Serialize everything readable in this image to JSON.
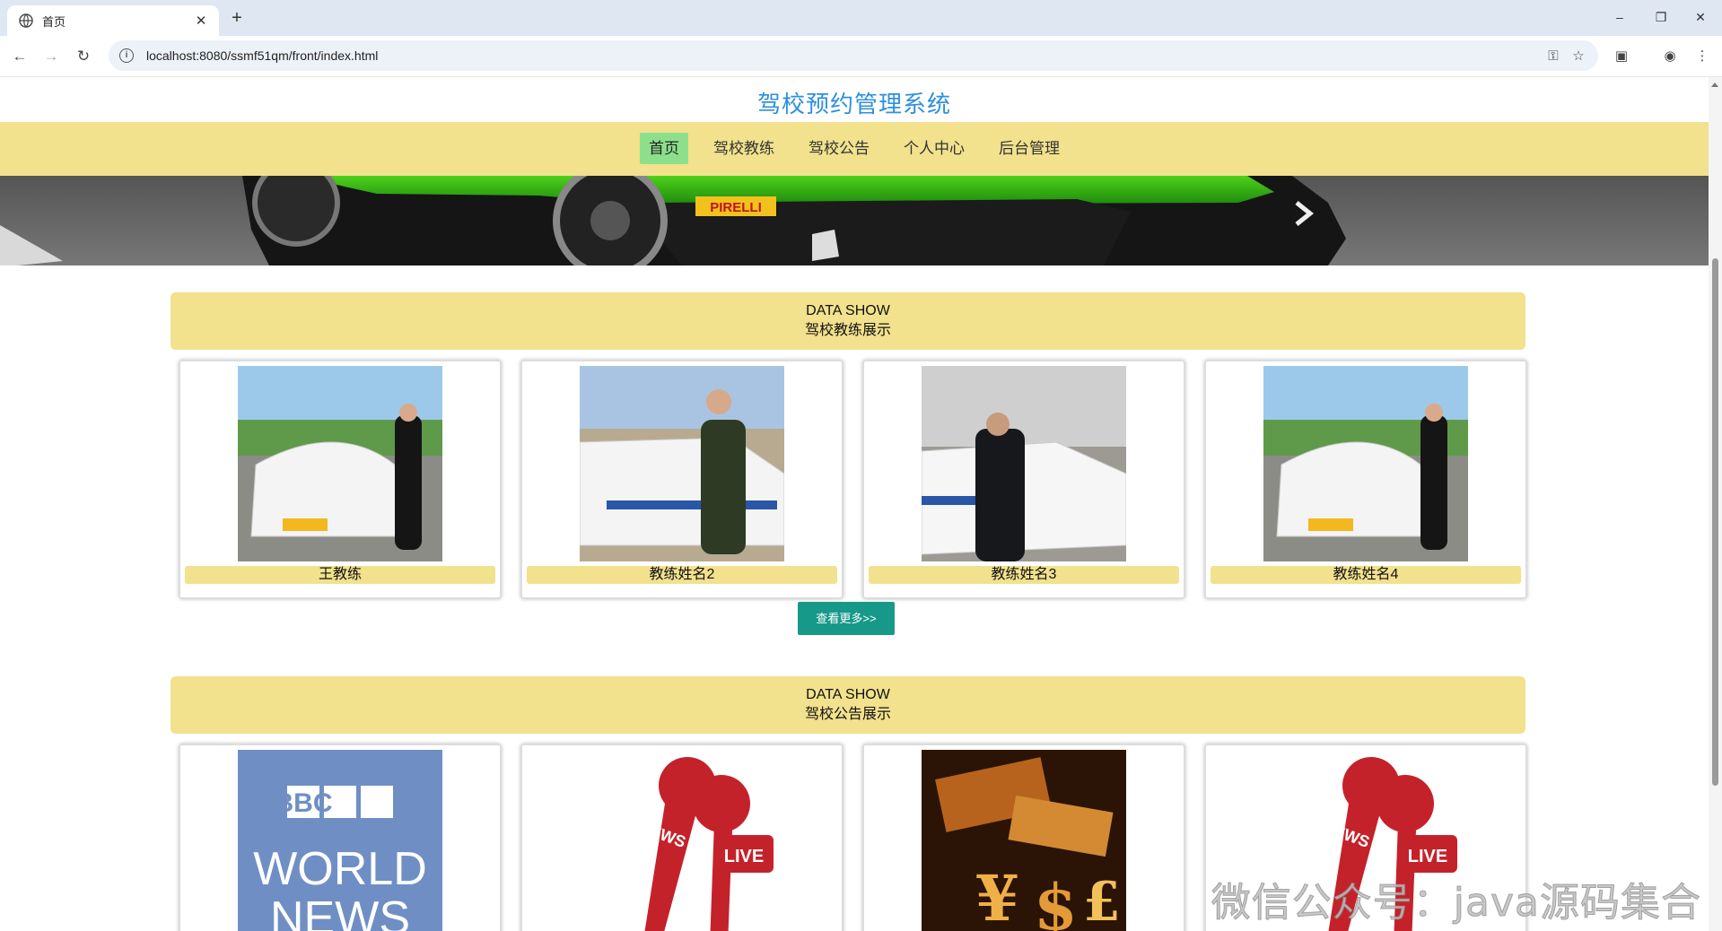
{
  "browser": {
    "tab_title": "首页",
    "new_tab": "+",
    "url": "localhost:8080/ssmf51qm/front/index.html",
    "window_controls": [
      "–",
      "❐",
      "✕"
    ]
  },
  "site": {
    "title": "驾校预约管理系统",
    "menu": [
      {
        "label": "首页",
        "active": true
      },
      {
        "label": "驾校教练",
        "active": false
      },
      {
        "label": "驾校公告",
        "active": false
      },
      {
        "label": "个人中心",
        "active": false
      },
      {
        "label": "后台管理",
        "active": false
      }
    ]
  },
  "coach_section": {
    "heading_en": "DATA SHOW",
    "heading_cn": "驾校教练展示",
    "coaches": [
      {
        "name": "王教练"
      },
      {
        "name": "教练姓名2"
      },
      {
        "name": "教练姓名3"
      },
      {
        "name": "教练姓名4"
      }
    ],
    "more_button": "查看更多>>"
  },
  "notice_section": {
    "heading_en": "DATA SHOW",
    "heading_cn": "驾校公告展示",
    "notices": [
      {
        "image": "bbc-world-news",
        "text_lines": [
          "BBC",
          "WORLD",
          "NEWS"
        ]
      },
      {
        "image": "news-live-microphone",
        "text_lines": [
          "NEWS",
          "LIVE"
        ]
      },
      {
        "image": "currency-symbols",
        "text_lines": []
      },
      {
        "image": "news-live-microphone",
        "text_lines": [
          "NEWS",
          "LIVE"
        ]
      }
    ]
  },
  "watermark": "微信公众号：java源码集合",
  "colors": {
    "title_blue": "#2f8fdc",
    "menu_yellow": "#f2e18d",
    "active_green": "#8de08b",
    "button_teal": "#17998a"
  }
}
